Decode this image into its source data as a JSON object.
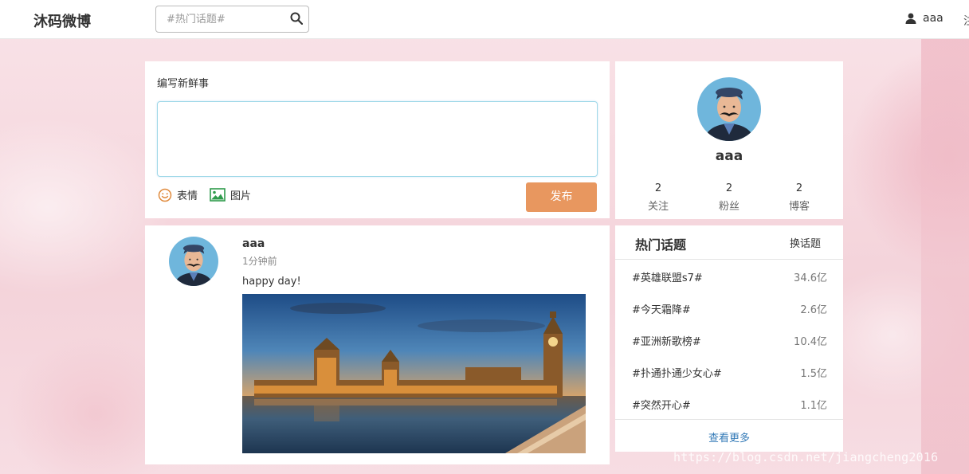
{
  "navbar": {
    "brand": "沐码微博",
    "search_placeholder": "#热门话题#",
    "search_icon": "search-icon",
    "username": "aaa",
    "user_icon": "user-icon",
    "extra": "注"
  },
  "composer": {
    "title": "编写新鲜事",
    "textarea_value": "",
    "emoji_label": "表情",
    "image_label": "图片",
    "publish_label": "发布",
    "accent_color": "#e8975f"
  },
  "profile": {
    "name": "aaa",
    "stats": [
      {
        "count": "2",
        "label": "关注"
      },
      {
        "count": "2",
        "label": "粉丝"
      },
      {
        "count": "2",
        "label": "博客"
      }
    ]
  },
  "post": {
    "author": "aaa",
    "time": "1分钟前",
    "text": "happy day!",
    "image": "city-landmark-photo"
  },
  "topics": {
    "title": "热门话题",
    "switch_label": "换话题",
    "items": [
      {
        "name": "#英雄联盟s7#",
        "count": "34.6亿"
      },
      {
        "name": "#今天霜降#",
        "count": "2.6亿"
      },
      {
        "name": "#亚洲新歌榜#",
        "count": "10.4亿"
      },
      {
        "name": "#扑通扑通少女心#",
        "count": "1.5亿"
      },
      {
        "name": "#突然开心#",
        "count": "1.1亿"
      }
    ],
    "more_label": "查看更多",
    "link_color": "#337ab7"
  },
  "watermark": "https://blog.csdn.net/jiangcheng2016"
}
